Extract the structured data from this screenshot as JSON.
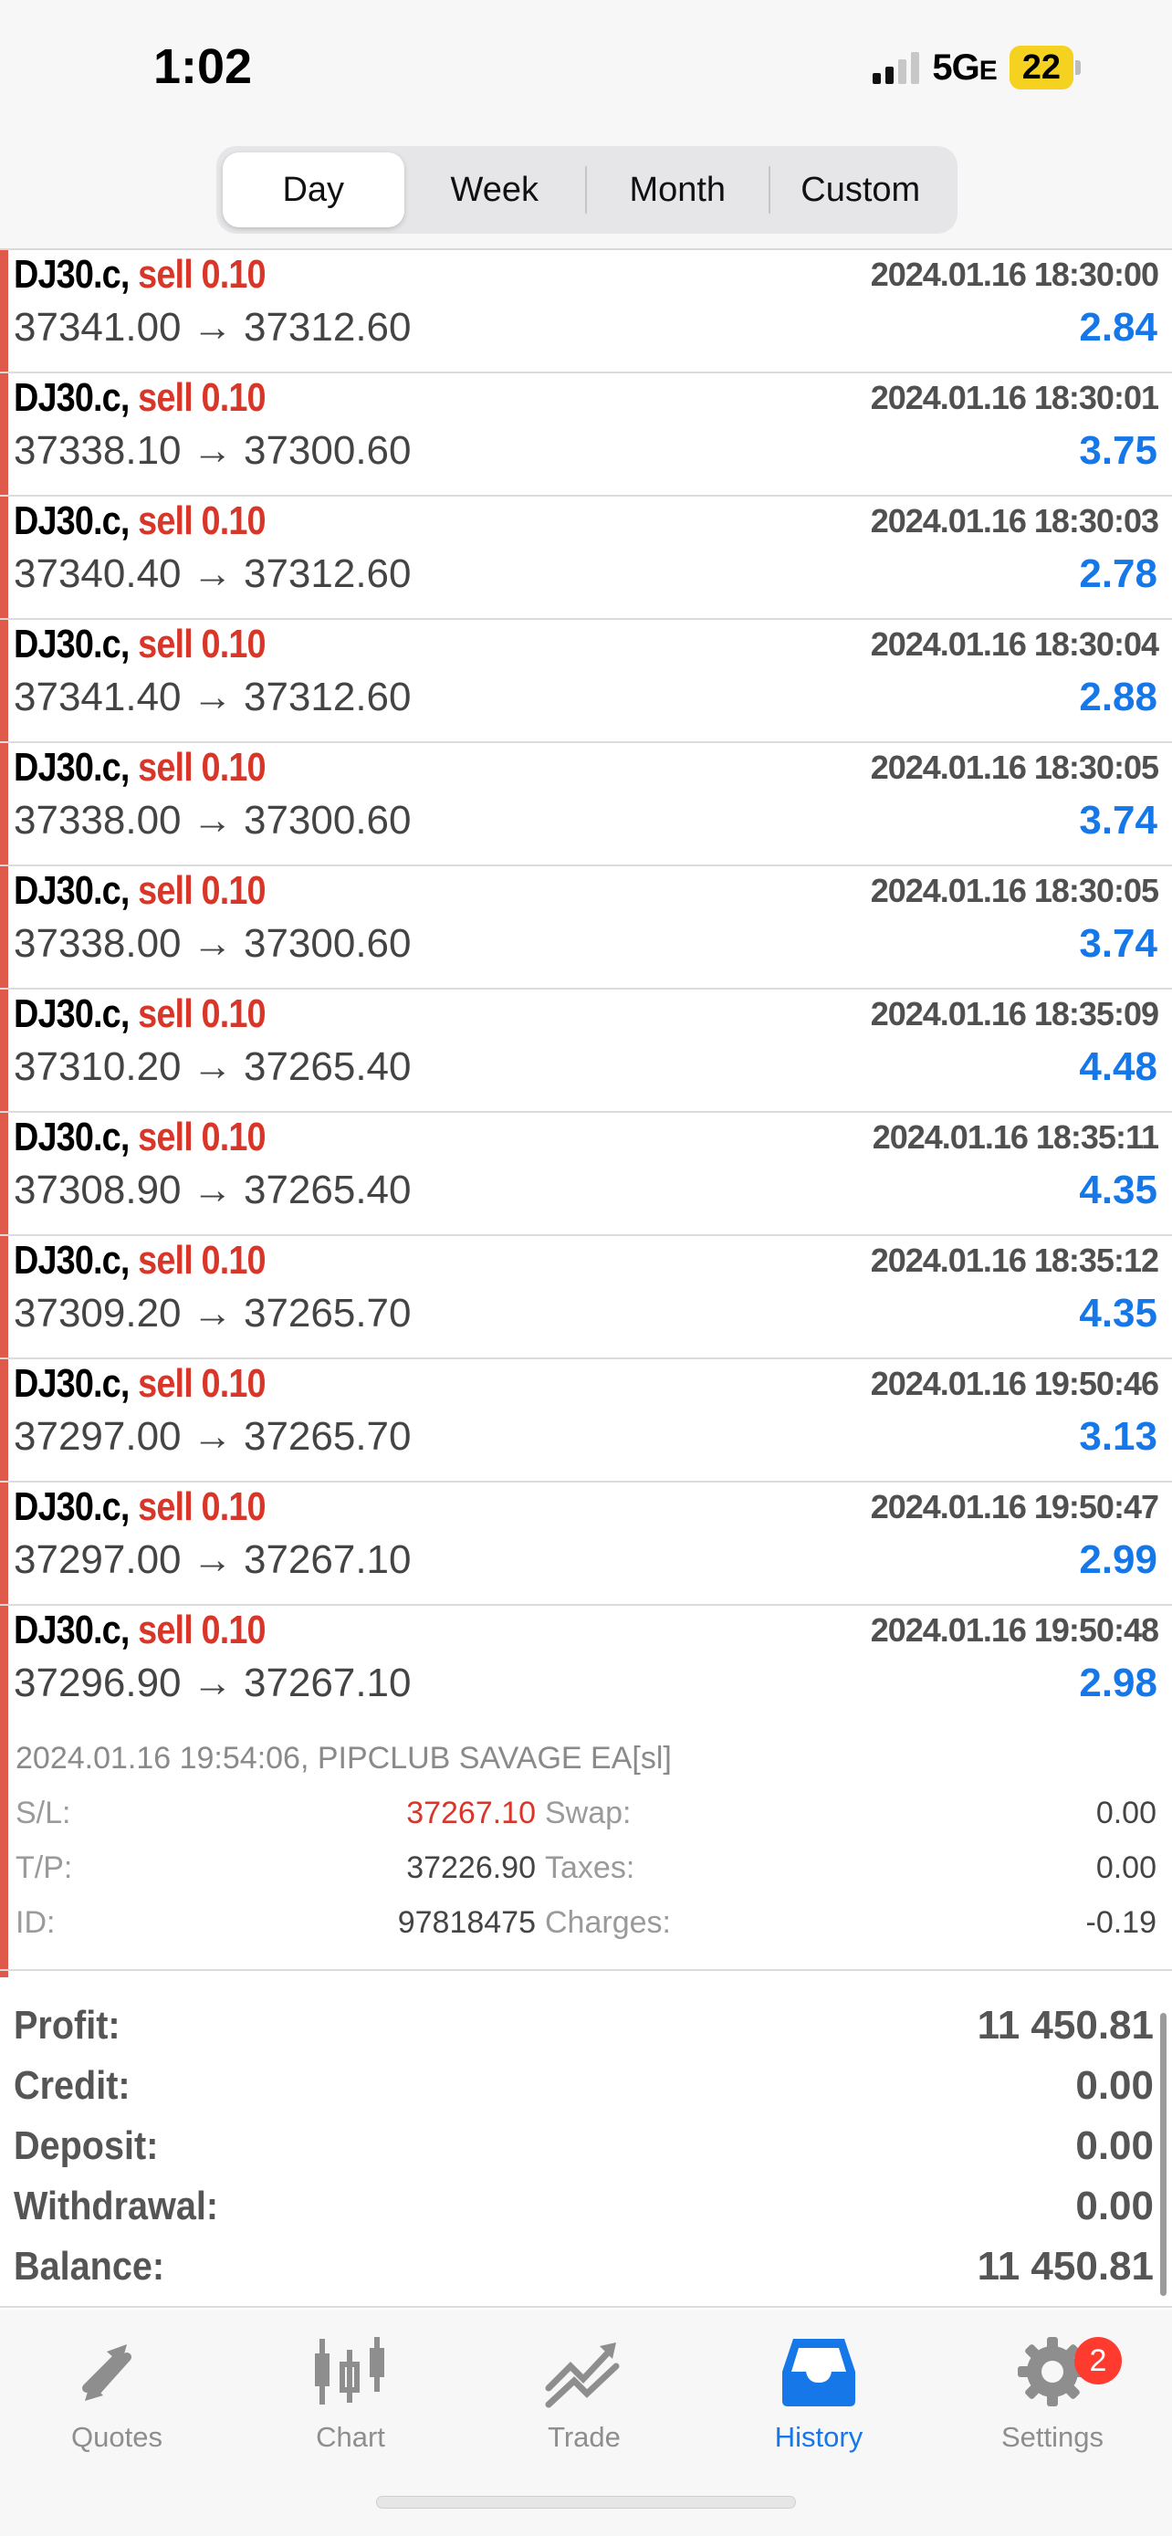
{
  "status": {
    "time": "1:02",
    "network": "5G",
    "network_suffix": "E",
    "battery": "22"
  },
  "segments": [
    "Day",
    "Week",
    "Month",
    "Custom"
  ],
  "deals": [
    {
      "symbol": "DJ30.c,",
      "side": "sell 0.10",
      "time": "2024.01.16 18:30:00",
      "prices": "37341.00 → 37312.60",
      "profit": "2.84"
    },
    {
      "symbol": "DJ30.c,",
      "side": "sell 0.10",
      "time": "2024.01.16 18:30:01",
      "prices": "37338.10 → 37300.60",
      "profit": "3.75"
    },
    {
      "symbol": "DJ30.c,",
      "side": "sell 0.10",
      "time": "2024.01.16 18:30:03",
      "prices": "37340.40 → 37312.60",
      "profit": "2.78"
    },
    {
      "symbol": "DJ30.c,",
      "side": "sell 0.10",
      "time": "2024.01.16 18:30:04",
      "prices": "37341.40 → 37312.60",
      "profit": "2.88"
    },
    {
      "symbol": "DJ30.c,",
      "side": "sell 0.10",
      "time": "2024.01.16 18:30:05",
      "prices": "37338.00 → 37300.60",
      "profit": "3.74"
    },
    {
      "symbol": "DJ30.c,",
      "side": "sell 0.10",
      "time": "2024.01.16 18:30:05",
      "prices": "37338.00 → 37300.60",
      "profit": "3.74"
    },
    {
      "symbol": "DJ30.c,",
      "side": "sell 0.10",
      "time": "2024.01.16 18:35:09",
      "prices": "37310.20 → 37265.40",
      "profit": "4.48"
    },
    {
      "symbol": "DJ30.c,",
      "side": "sell 0.10",
      "time": "2024.01.16 18:35:11",
      "prices": "37308.90 → 37265.40",
      "profit": "4.35"
    },
    {
      "symbol": "DJ30.c,",
      "side": "sell 0.10",
      "time": "2024.01.16 18:35:12",
      "prices": "37309.20 → 37265.70",
      "profit": "4.35"
    },
    {
      "symbol": "DJ30.c,",
      "side": "sell 0.10",
      "time": "2024.01.16 19:50:46",
      "prices": "37297.00 → 37265.70",
      "profit": "3.13"
    },
    {
      "symbol": "DJ30.c,",
      "side": "sell 0.10",
      "time": "2024.01.16 19:50:47",
      "prices": "37297.00 → 37267.10",
      "profit": "2.99"
    },
    {
      "symbol": "DJ30.c,",
      "side": "sell 0.10",
      "time": "2024.01.16 19:50:48",
      "prices": "37296.90 → 37267.10",
      "profit": "2.98"
    }
  ],
  "expanded": {
    "comment": "2024.01.16 19:54:06, PIPCLUB SAVAGE EA[sl]",
    "sl_label": "S/L:",
    "sl": "37267.10",
    "tp_label": "T/P:",
    "tp": "37226.90",
    "id_label": "ID:",
    "id": "97818475",
    "swap_label": "Swap:",
    "swap": "0.00",
    "taxes_label": "Taxes:",
    "taxes": "0.00",
    "charges_label": "Charges:",
    "charges": "-0.19"
  },
  "summary": [
    {
      "label": "Profit:",
      "value": "11 450.81"
    },
    {
      "label": "Credit:",
      "value": "0.00"
    },
    {
      "label": "Deposit:",
      "value": "0.00"
    },
    {
      "label": "Withdrawal:",
      "value": "0.00"
    },
    {
      "label": "Balance:",
      "value": "11 450.81"
    }
  ],
  "tabs": [
    {
      "label": "Quotes",
      "icon": "quotes-icon"
    },
    {
      "label": "Chart",
      "icon": "chart-icon"
    },
    {
      "label": "Trade",
      "icon": "trade-icon"
    },
    {
      "label": "History",
      "icon": "history-icon"
    },
    {
      "label": "Settings",
      "icon": "gear-icon",
      "badge": "2"
    }
  ],
  "colors": {
    "sell": "#d9362a",
    "profit": "#1677e8",
    "accent_bar": "#e05a4c",
    "tab_active": "#1677e8",
    "badge": "#ff3b30"
  }
}
